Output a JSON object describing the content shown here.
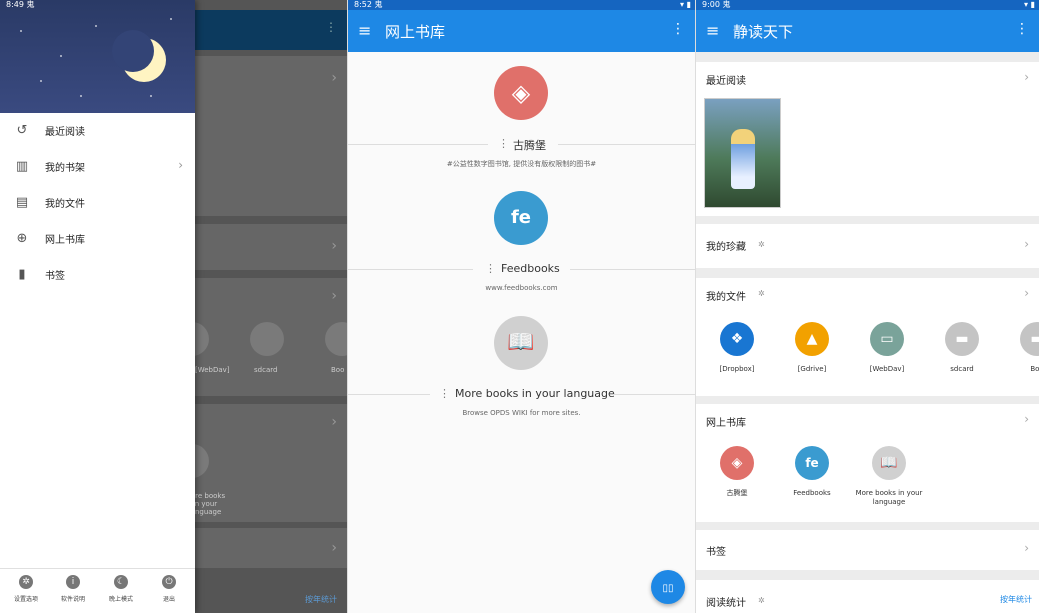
{
  "panel1": {
    "status_time": "8:49",
    "status_icon": "鬼",
    "drawer_items": [
      {
        "label": "最近阅读",
        "icon": "history-icon",
        "glyph": "↺",
        "chevron": ""
      },
      {
        "label": "我的书架",
        "icon": "bookshelf-icon",
        "glyph": "▥",
        "chevron": "›"
      },
      {
        "label": "我的文件",
        "icon": "document-icon",
        "glyph": "▤",
        "chevron": ""
      },
      {
        "label": "网上书库",
        "icon": "globe-icon",
        "glyph": "⊕",
        "chevron": ""
      },
      {
        "label": "书签",
        "icon": "bookmark-book-icon",
        "glyph": "▮",
        "chevron": ""
      }
    ],
    "footer": [
      {
        "label": "设置选项",
        "icon": "gear-icon",
        "glyph": "✲"
      },
      {
        "label": "软件说明",
        "icon": "info-icon",
        "glyph": "i"
      },
      {
        "label": "晚上模式",
        "icon": "moon-icon",
        "glyph": "☾"
      },
      {
        "label": "退出",
        "icon": "power-icon",
        "glyph": "⏻"
      }
    ],
    "behind": {
      "label_dav": "[WebDav]",
      "label_sdcard": "sdcard",
      "label_boo": "Boo",
      "label_more": "More books in your language",
      "link": "按年统计"
    }
  },
  "panel2": {
    "status_time": "8:52",
    "status_icon": "鬼",
    "title": "网上书库",
    "libraries": [
      {
        "name": "古腾堡",
        "desc": "#公益性数字图书馆, 提供没有版权限制的图书#",
        "color": "#e0706a",
        "glyph": "◈"
      },
      {
        "name": "Feedbooks",
        "desc": "www.feedbooks.com",
        "color": "#3a9bd0",
        "glyph": "fe"
      },
      {
        "name": "More books in your language",
        "desc": "Browse OPDS WIKI for more sites.",
        "color": "#d0d0d0",
        "glyph": "📖"
      }
    ],
    "fab_glyph": "▯▯"
  },
  "panel3": {
    "status_time": "9:00",
    "status_icon": "鬼",
    "title": "静读天下",
    "sections": {
      "recent": "最近阅读",
      "favorites": "我的珍藏",
      "files": "我的文件",
      "library": "网上书库",
      "bookmarks": "书签",
      "stats": "阅读统计",
      "stats_link": "按年统计"
    },
    "files": [
      {
        "label": "[Dropbox]",
        "color": "#1976d2",
        "icon": "dropbox-icon",
        "glyph": "❖"
      },
      {
        "label": "[Gdrive]",
        "color": "#f2a100",
        "icon": "google-drive-icon",
        "glyph": "▲"
      },
      {
        "label": "[WebDav]",
        "color": "#7aa39a",
        "icon": "monitor-icon",
        "glyph": "▭"
      },
      {
        "label": "sdcard",
        "color": "#c4c4c4",
        "icon": "folder-icon",
        "glyph": "▬"
      },
      {
        "label": "Boo",
        "color": "#c4c4c4",
        "icon": "folder-icon",
        "glyph": "▬"
      }
    ],
    "libraries": [
      {
        "label": "古腾堡",
        "color": "#e0706a",
        "icon": "gutenberg-icon",
        "glyph": "◈"
      },
      {
        "label": "Feedbooks",
        "color": "#3a9bd0",
        "icon": "feedbooks-icon",
        "glyph": "fe"
      },
      {
        "label": "More books in your language",
        "color": "#d0d0d0",
        "icon": "open-book-icon",
        "glyph": "📖"
      }
    ]
  },
  "icons": {
    "menu": "≡",
    "more": "⋮",
    "chevron": "›",
    "gear": "✲",
    "status_right": "▾ ▮"
  }
}
